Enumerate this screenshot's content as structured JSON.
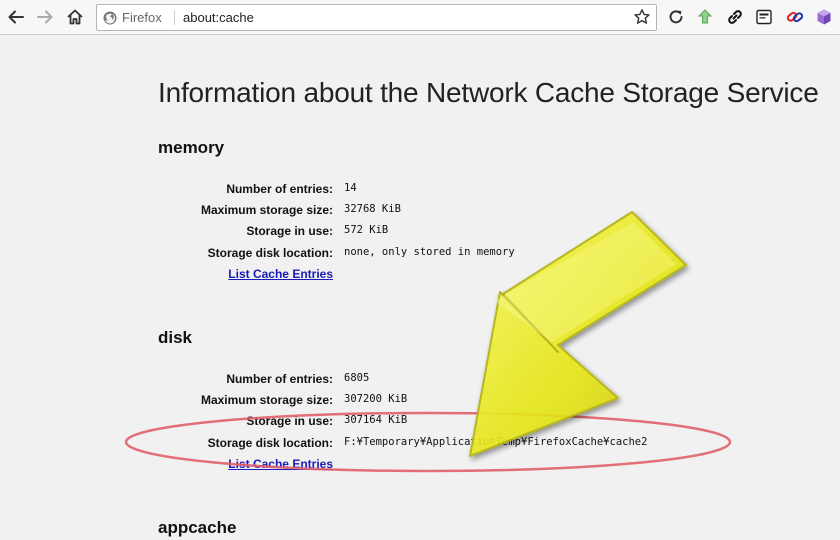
{
  "browser": {
    "identity_label": "Firefox",
    "url": "about:cache"
  },
  "page": {
    "title": "Information about the Network Cache Storage Service",
    "sections": [
      {
        "heading": "memory",
        "rows": [
          {
            "label": "Number of entries:",
            "value": "14"
          },
          {
            "label": "Maximum storage size:",
            "value": "32768 KiB"
          },
          {
            "label": "Storage in use:",
            "value": "572 KiB"
          },
          {
            "label": "Storage disk location:",
            "value": "none, only stored in memory"
          }
        ],
        "link": "List Cache Entries"
      },
      {
        "heading": "disk",
        "rows": [
          {
            "label": "Number of entries:",
            "value": "6805"
          },
          {
            "label": "Maximum storage size:",
            "value": "307200 KiB"
          },
          {
            "label": "Storage in use:",
            "value": "307164 KiB"
          },
          {
            "label": "Storage disk location:",
            "value": "F:¥Temporary¥ApplicationTemp¥FirefoxCache¥cache2"
          }
        ],
        "link": "List Cache Entries"
      },
      {
        "heading": "appcache",
        "rows": [],
        "link": ""
      }
    ]
  },
  "colors": {
    "arrow_fill": "#eaea1e",
    "ellipse_stroke": "#e0606a",
    "link": "#1a1ab8"
  }
}
